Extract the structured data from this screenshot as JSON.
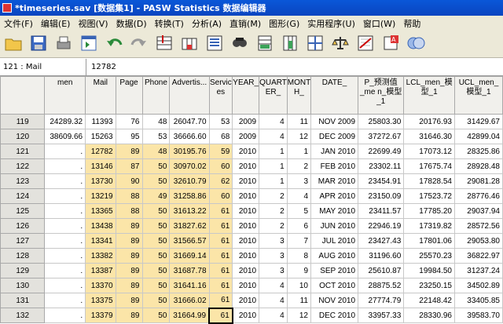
{
  "window": {
    "title": "*timeseries.sav [数据集1] - PASW Statistics 数据编辑器"
  },
  "menu": [
    "文件(F)",
    "编辑(E)",
    "视图(V)",
    "数据(D)",
    "转换(T)",
    "分析(A)",
    "直销(M)",
    "图形(G)",
    "实用程序(U)",
    "窗口(W)",
    "帮助"
  ],
  "toolbar": [
    "open-folder-icon",
    "save-icon",
    "print-icon",
    "dialog-recall-icon",
    "undo-icon",
    "redo-icon",
    "goto-case-icon",
    "goto-variable-icon",
    "variables-icon",
    "find-icon",
    "insert-cases-icon",
    "insert-variable-icon",
    "split-file-icon",
    "weight-cases-icon",
    "select-cases-icon",
    "value-labels-icon",
    "use-sets-icon"
  ],
  "cellbar": {
    "ref": "121 : Mail",
    "value": "12782"
  },
  "columns": [
    "men",
    "Mail",
    "Page",
    "Phone",
    "Advertis...",
    "Servic es",
    "YEAR_",
    "QUART ER_",
    "MONT H_",
    "DATE_",
    "P_预测值_me n_模型_1",
    "LCL_men_模型_1",
    "UCL_men_模型_1"
  ],
  "rows": [
    [
      "119",
      "24289.32",
      "11393",
      "76",
      "48",
      "26047.70",
      "53",
      "2009",
      "4",
      "11",
      "NOV 2009",
      "25803.30",
      "20176.93",
      "31429.67"
    ],
    [
      "120",
      "38609.66",
      "15263",
      "95",
      "53",
      "36666.60",
      "68",
      "2009",
      "4",
      "12",
      "DEC 2009",
      "37272.67",
      "31646.30",
      "42899.04"
    ],
    [
      "121",
      ".",
      "12782",
      "89",
      "48",
      "30195.76",
      "59",
      "2010",
      "1",
      "1",
      "JAN 2010",
      "22699.49",
      "17073.12",
      "28325.86"
    ],
    [
      "122",
      ".",
      "13146",
      "87",
      "50",
      "30970.02",
      "60",
      "2010",
      "1",
      "2",
      "FEB 2010",
      "23302.11",
      "17675.74",
      "28928.48"
    ],
    [
      "123",
      ".",
      "13730",
      "90",
      "50",
      "32610.79",
      "62",
      "2010",
      "1",
      "3",
      "MAR 2010",
      "23454.91",
      "17828.54",
      "29081.28"
    ],
    [
      "124",
      ".",
      "13219",
      "88",
      "49",
      "31258.86",
      "60",
      "2010",
      "2",
      "4",
      "APR 2010",
      "23150.09",
      "17523.72",
      "28776.46"
    ],
    [
      "125",
      ".",
      "13365",
      "88",
      "50",
      "31613.22",
      "61",
      "2010",
      "2",
      "5",
      "MAY 2010",
      "23411.57",
      "17785.20",
      "29037.94"
    ],
    [
      "126",
      ".",
      "13438",
      "89",
      "50",
      "31827.62",
      "61",
      "2010",
      "2",
      "6",
      "JUN 2010",
      "22946.19",
      "17319.82",
      "28572.56"
    ],
    [
      "127",
      ".",
      "13341",
      "89",
      "50",
      "31566.57",
      "61",
      "2010",
      "3",
      "7",
      "JUL 2010",
      "23427.43",
      "17801.06",
      "29053.80"
    ],
    [
      "128",
      ".",
      "13382",
      "89",
      "50",
      "31669.14",
      "61",
      "2010",
      "3",
      "8",
      "AUG 2010",
      "31196.60",
      "25570.23",
      "36822.97"
    ],
    [
      "129",
      ".",
      "13387",
      "89",
      "50",
      "31687.78",
      "61",
      "2010",
      "3",
      "9",
      "SEP 2010",
      "25610.87",
      "19984.50",
      "31237.24"
    ],
    [
      "130",
      ".",
      "13370",
      "89",
      "50",
      "31641.16",
      "61",
      "2010",
      "4",
      "10",
      "OCT 2010",
      "28875.52",
      "23250.15",
      "34502.89"
    ],
    [
      "131",
      ".",
      "13375",
      "89",
      "50",
      "31666.02",
      "61",
      "2010",
      "4",
      "11",
      "NOV 2010",
      "27774.79",
      "22148.42",
      "33405.85"
    ],
    [
      "132",
      ".",
      "13379",
      "89",
      "50",
      "31664.99",
      "61",
      "2010",
      "4",
      "12",
      "DEC 2010",
      "33957.33",
      "28330.96",
      "39583.70"
    ]
  ],
  "highlight_columns": [
    2,
    3,
    4,
    5,
    6
  ],
  "selected_cell": {
    "row": 13,
    "col": 6
  }
}
